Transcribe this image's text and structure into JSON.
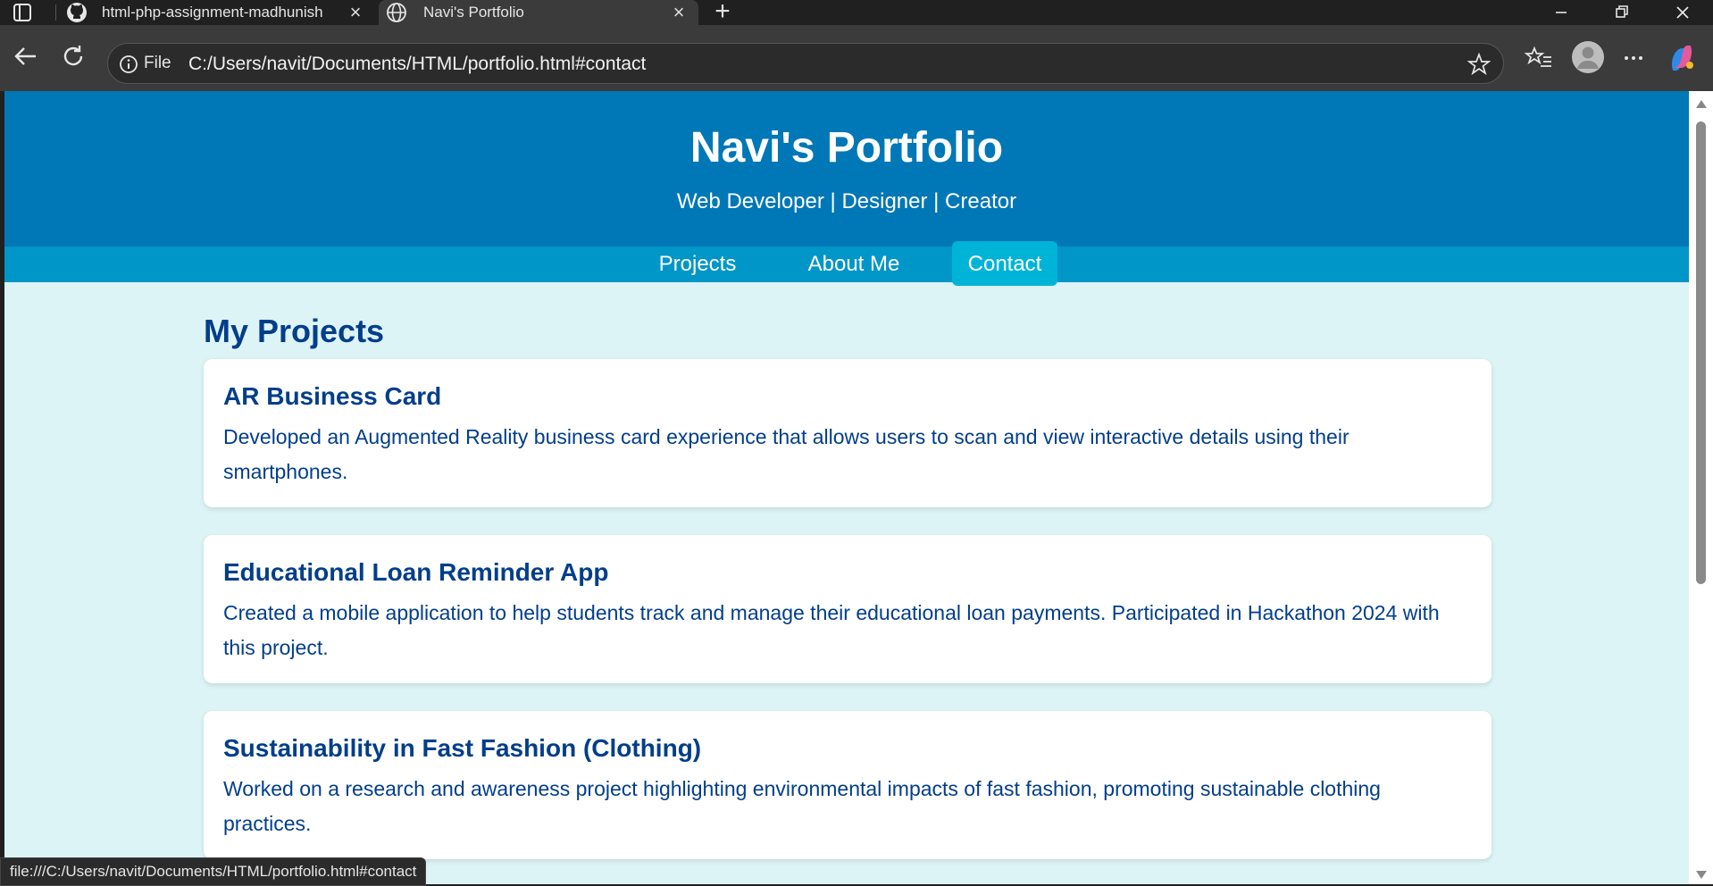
{
  "browser": {
    "tabs": [
      {
        "title": "html-php-assignment-madhunish",
        "icon": "github-icon",
        "active": false
      },
      {
        "title": "Navi's Portfolio",
        "icon": "globe-icon",
        "active": true
      }
    ],
    "address": {
      "scheme_label": "File",
      "url": "C:/Users/navit/Documents/HTML/portfolio.html#contact"
    },
    "status_url": "file:///C:/Users/navit/Documents/HTML/portfolio.html#contact"
  },
  "header": {
    "title": "Navi's Portfolio",
    "tagline": "Web Developer | Designer | Creator"
  },
  "nav": {
    "items": [
      {
        "label": "Projects",
        "active": false
      },
      {
        "label": "About Me",
        "active": false
      },
      {
        "label": "Contact",
        "active": true
      }
    ]
  },
  "projects": {
    "heading": "My Projects",
    "items": [
      {
        "title": "AR Business Card",
        "description": "Developed an Augmented Reality business card experience that allows users to scan and view interactive details using their smartphones."
      },
      {
        "title": "Educational Loan Reminder App",
        "description": "Created a mobile application to help students track and manage their educational loan payments. Participated in Hackathon 2024 with this project."
      },
      {
        "title": "Sustainability in Fast Fashion (Clothing)",
        "description": "Worked on a research and awareness project highlighting environmental impacts of fast fashion, promoting sustainable clothing practices."
      }
    ]
  },
  "colors": {
    "header_bg": "#0077b6",
    "nav_bg": "#0096c7",
    "nav_active_bg": "#00b4d8",
    "page_bg": "#ddf4f6",
    "text_dark_blue": "#023e8a"
  }
}
